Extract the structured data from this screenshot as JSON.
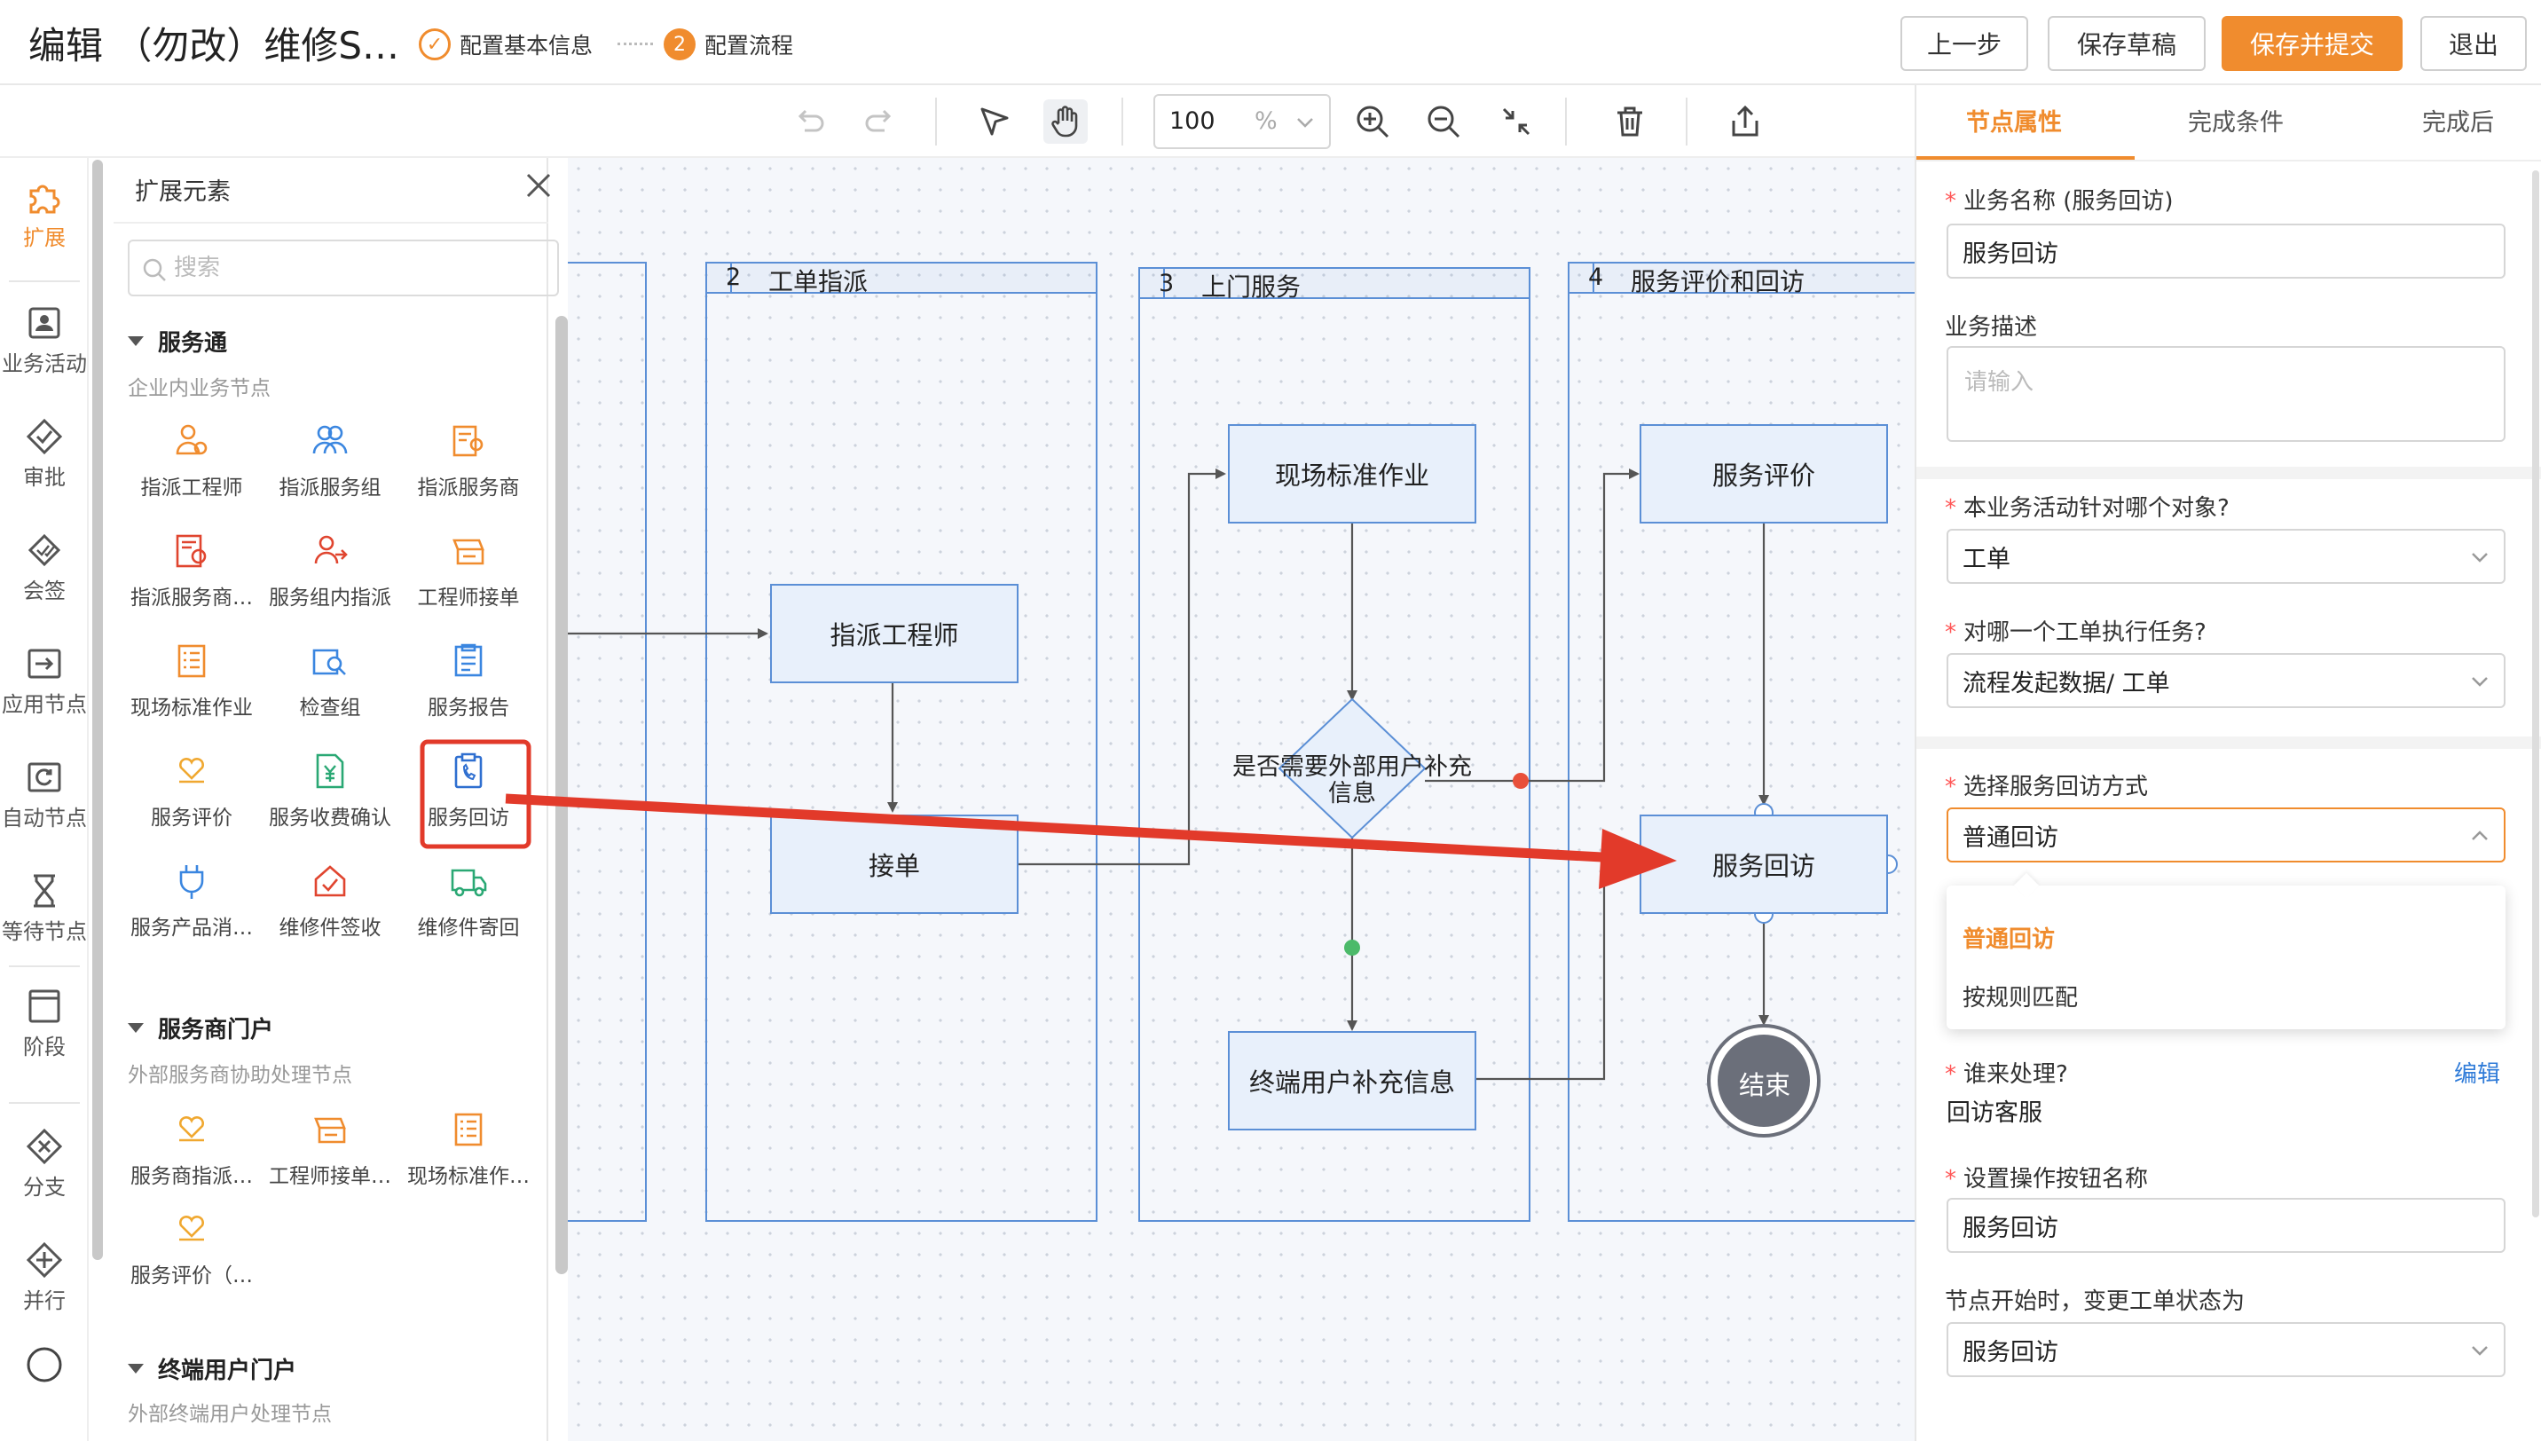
{
  "header": {
    "title": "编辑 （勿改）维修S…",
    "steps": [
      {
        "num": "✓",
        "label": "配置基本信息"
      },
      {
        "num": "2",
        "label": "配置流程"
      }
    ],
    "buttons": {
      "prev": "上一步",
      "draft": "保存草稿",
      "submit": "保存并提交",
      "exit": "退出"
    },
    "accent_color": "#f08c2e"
  },
  "toolbar": {
    "zoom_value": "100",
    "zoom_unit": "%",
    "icons": [
      "undo-icon",
      "redo-icon",
      "select-pointer-icon",
      "hand-pan-icon",
      "zoom-in-icon",
      "zoom-out-icon",
      "fit-screen-icon",
      "delete-icon",
      "export-icon"
    ]
  },
  "rail": {
    "items": [
      {
        "label": "扩展",
        "icon": "puzzle-icon"
      },
      {
        "label": "业务活动",
        "icon": "activity-icon"
      },
      {
        "label": "审批",
        "icon": "approval-icon"
      },
      {
        "label": "会签",
        "icon": "countersign-icon"
      },
      {
        "label": "应用节点",
        "icon": "app-node-icon"
      },
      {
        "label": "自动节点",
        "icon": "auto-node-icon"
      },
      {
        "label": "等待节点",
        "icon": "hourglass-icon"
      },
      {
        "label": "阶段",
        "icon": "stage-icon"
      },
      {
        "label": "分支",
        "icon": "branch-icon"
      },
      {
        "label": "并行",
        "icon": "parallel-icon"
      },
      {
        "label": "",
        "icon": "circle-end-icon"
      }
    ]
  },
  "panel": {
    "title": "扩展元素",
    "search_placeholder": "搜索",
    "groups": [
      {
        "title": "服务通",
        "subtitle": "企业内业务节点",
        "items": [
          "指派工程师",
          "指派服务组",
          "指派服务商",
          "指派服务商…",
          "服务组内指派",
          "工程师接单",
          "现场标准作业",
          "检查组",
          "服务报告",
          "服务评价",
          "服务收费确认",
          "服务回访",
          "服务产品消…",
          "维修件签收",
          "维修件寄回"
        ]
      },
      {
        "title": "服务商门户",
        "subtitle": "外部服务商协助处理节点",
        "items": [
          "服务商指派…",
          "工程师接单…",
          "现场标准作…",
          "服务评价（…"
        ]
      },
      {
        "title": "终端用户门户",
        "subtitle": "外部终端用户处理节点",
        "items": []
      }
    ]
  },
  "canvas": {
    "lanes": [
      {
        "num": "2",
        "title": "工单指派"
      },
      {
        "num": "3",
        "title": "上门服务"
      },
      {
        "num": "4",
        "title": "服务评价和回访"
      }
    ],
    "nodes": {
      "assign_engineer": "指派工程师",
      "accept_order": "接单",
      "onsite_work": "现场标准作业",
      "decision": "是否需要外部用户补充信息",
      "user_supplement": "终端用户补充信息",
      "service_eval": "服务评价",
      "service_revisit": "服务回访",
      "end": "结束"
    }
  },
  "right_panel": {
    "tabs": [
      "节点属性",
      "完成条件",
      "完成后"
    ],
    "fields": {
      "biz_name_label": "业务名称 (服务回访)",
      "biz_name_value": "服务回访",
      "biz_desc_label": "业务描述",
      "biz_desc_placeholder": "请输入",
      "target_label": "本业务活动针对哪个对象?",
      "target_value": "工单",
      "which_label": "对哪一个工单执行任务?",
      "which_value": "流程发起数据/ 工单",
      "revisit_mode_label": "选择服务回访方式",
      "revisit_mode_value": "普通回访",
      "revisit_options": [
        "普通回访",
        "按规则匹配"
      ],
      "handler_label": "谁来处理?",
      "handler_edit": "编辑",
      "handler_value": "回访客服",
      "button_name_label": "设置操作按钮名称",
      "button_name_value": "服务回访",
      "status_label": "节点开始时，变更工单状态为",
      "status_value": "服务回访"
    }
  }
}
